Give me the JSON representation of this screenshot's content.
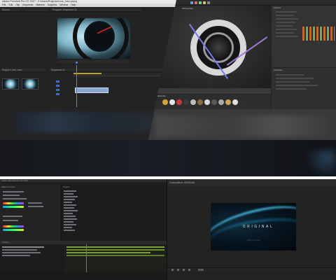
{
  "premiere": {
    "window_title": "Adobe Premiere Pro CC 2017 - C:\\Users\\Projects\\Lens_Intro.prproj",
    "menu": [
      "File",
      "Edit",
      "Clip",
      "Sequence",
      "Markers",
      "Graphics",
      "Window",
      "Help"
    ],
    "source_panel": "Source",
    "program_panel": "Program: Sequence 01",
    "project_panel": "Project: Lens_Intro",
    "timeline_panel": "Sequence 01",
    "accent_color": "#4b8ad9",
    "clip_color": "#8aa9d2"
  },
  "cinema4d": {
    "viewport_label": "Perspective",
    "object_manager_label": "Objects",
    "attribute_manager_label": "Attributes",
    "material_manager_label": "Materials"
  },
  "aftereffects": {
    "window_title": "Adobe After Effects CC 2017",
    "effects_panel": "Effect Controls",
    "project_panel": "Project",
    "timeline_panel": "Comp 1",
    "track_color": "#7ba03a"
  },
  "composition": {
    "panel_label": "Composition: ORIGINAL",
    "title_text": "ORIGINAL",
    "subtitle_text": "ORIGINAL",
    "glow_color": "#4fd3ff"
  }
}
